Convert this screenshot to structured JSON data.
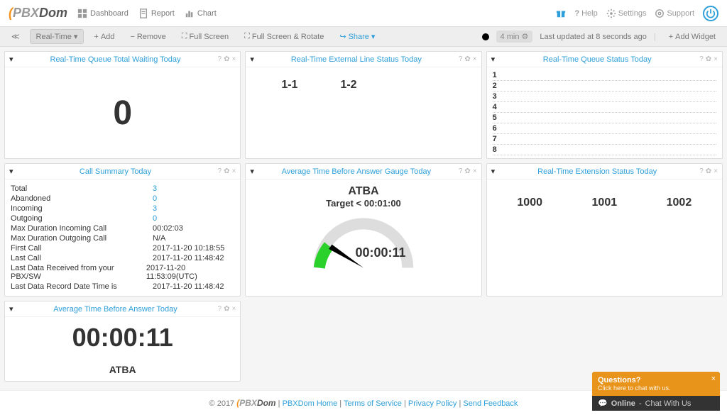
{
  "brand": {
    "prefix": "PBX",
    "suffix": "Dom"
  },
  "nav": {
    "dashboard": "Dashboard",
    "report": "Report",
    "chart": "Chart"
  },
  "header_right": {
    "help": "Help",
    "settings": "Settings",
    "support": "Support"
  },
  "toolbar": {
    "realtime": "Real-Time",
    "add": "Add",
    "remove": "Remove",
    "fullscreen": "Full Screen",
    "fullscreen_rotate": "Full Screen & Rotate",
    "share": "Share",
    "interval": "4 min",
    "last_updated": "Last updated at 8 seconds ago",
    "add_widget": "Add  Widget"
  },
  "widgets": {
    "queue_wait": {
      "title": "Real-Time Queue Total Waiting Today",
      "value": "0"
    },
    "ext_line": {
      "title": "Real-Time External Line Status Today",
      "lines": [
        "1-1",
        "1-2"
      ]
    },
    "queue_status": {
      "title": "Real-Time Queue Status Today",
      "rows": [
        "1",
        "2",
        "3",
        "4",
        "5",
        "6",
        "7",
        "8"
      ]
    },
    "call_summary": {
      "title": "Call Summary Today",
      "rows": [
        {
          "label": "Total",
          "value": "3",
          "link": true
        },
        {
          "label": "Abandoned",
          "value": "0",
          "link": true
        },
        {
          "label": "Incoming",
          "value": "3",
          "link": true
        },
        {
          "label": "Outgoing",
          "value": "0",
          "link": true
        },
        {
          "label": "Max Duration Incoming Call",
          "value": "00:02:03"
        },
        {
          "label": "Max Duration Outgoing Call",
          "value": "N/A"
        },
        {
          "label": "First Call",
          "value": "2017-11-20 10:18:55"
        },
        {
          "label": "Last Call",
          "value": "2017-11-20 11:48:42"
        },
        {
          "label": "Last Data Received from your PBX/SW",
          "value": "2017-11-20 11:53:09(UTC)"
        },
        {
          "label": "Last Data Record Date Time is",
          "value": "2017-11-20 11:48:42"
        }
      ]
    },
    "gauge": {
      "title": "Average Time Before Answer Gauge Today",
      "label": "ATBA",
      "target": "Target < 00:01:00",
      "value": "00:00:11"
    },
    "ext_status": {
      "title": "Real-Time Extension Status Today",
      "exts": [
        "1000",
        "1001",
        "1002"
      ]
    },
    "atba": {
      "title": "Average Time Before Answer Today",
      "value": "00:00:11",
      "label": "ATBA"
    }
  },
  "footer": {
    "copyright": "© 2017",
    "home": "PBXDom Home",
    "terms": "Terms of Service",
    "privacy": "Privacy Policy",
    "feedback": "Send Feedback"
  },
  "chat": {
    "q": "Questions?",
    "sub": "Click here to chat with us.",
    "online": "Online",
    "cwu": "Chat With Us"
  }
}
